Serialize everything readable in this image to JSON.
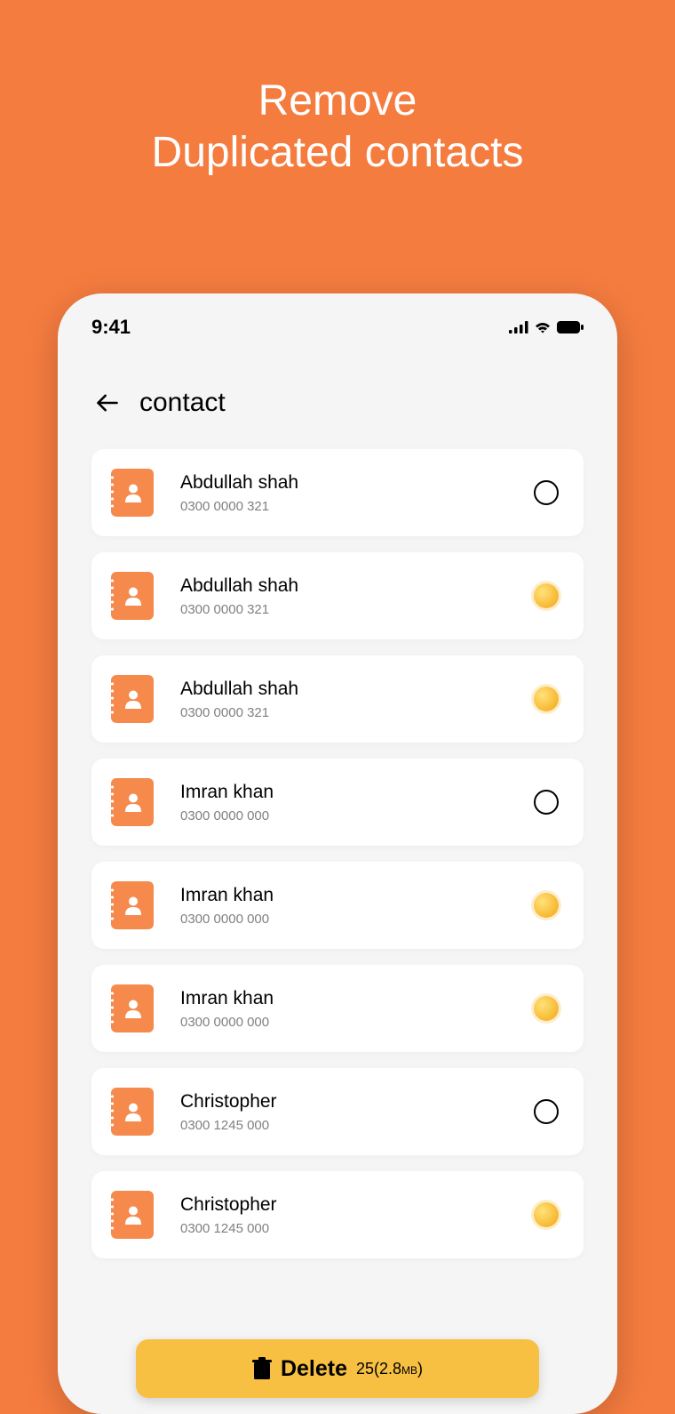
{
  "promo": {
    "line1": "Remove",
    "line2": "Duplicated contacts"
  },
  "statusBar": {
    "time": "9:41"
  },
  "header": {
    "title": "contact"
  },
  "contacts": [
    {
      "name": "Abdullah shah",
      "phone": "0300 0000 321",
      "selected": false
    },
    {
      "name": "Abdullah shah",
      "phone": "0300 0000 321",
      "selected": true
    },
    {
      "name": "Abdullah shah",
      "phone": "0300 0000 321",
      "selected": true
    },
    {
      "name": "Imran khan",
      "phone": "0300 0000 000",
      "selected": false
    },
    {
      "name": "Imran khan",
      "phone": "0300 0000 000",
      "selected": true
    },
    {
      "name": "Imran khan",
      "phone": "0300 0000 000",
      "selected": true
    },
    {
      "name": "Christopher",
      "phone": "0300 1245 000",
      "selected": false
    },
    {
      "name": "Christopher",
      "phone": "0300 1245 000",
      "selected": true
    }
  ],
  "deleteBar": {
    "label": "Delete",
    "count": "25",
    "size": "2.8",
    "unit": "MB"
  }
}
